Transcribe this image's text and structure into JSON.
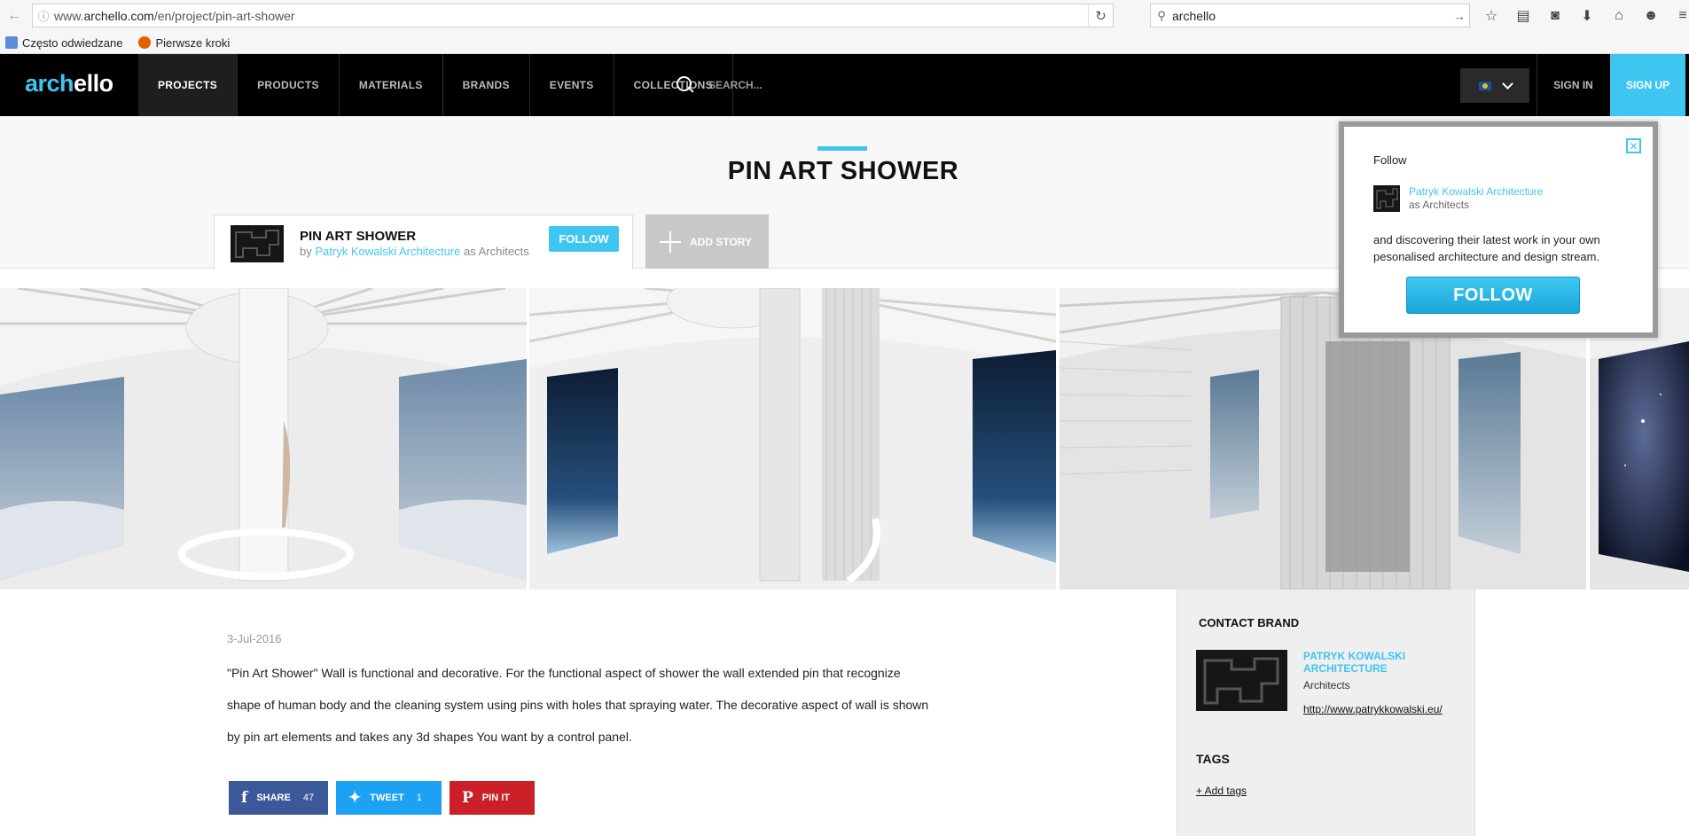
{
  "browser": {
    "url_prefix": "www.",
    "url_domain": "archello.com",
    "url_path": "/en/project/pin-art-shower",
    "search_value": "archello",
    "bookmarks": [
      {
        "label": "Często odwiedzane"
      },
      {
        "label": "Pierwsze kroki"
      }
    ]
  },
  "site": {
    "logo_part1": "arch",
    "logo_part2": "ello",
    "nav": [
      {
        "label": "PROJECTS"
      },
      {
        "label": "PRODUCTS"
      },
      {
        "label": "MATERIALS"
      },
      {
        "label": "BRANDS"
      },
      {
        "label": "EVENTS"
      },
      {
        "label": "COLLECTIONS"
      }
    ],
    "search_placeholder": "SEARCH...",
    "sign_in": "SIGN IN",
    "sign_up": "SIGN UP",
    "accent_color": "#3ec6f0"
  },
  "project": {
    "title": "PIN ART SHOWER",
    "card_title": "PIN ART SHOWER",
    "by_prefix": "by",
    "author": "Patryk Kowalski Architecture",
    "author_role": "as Architects",
    "follow_label": "FOLLOW",
    "add_story_label": "ADD STORY",
    "date": "3-Jul-2016",
    "description": "\"Pin Art Shower\" Wall is functional and decorative. For the functional aspect of shower the wall extended pin that recognize shape of human body and the cleaning system using pins with holes that spraying water. The decorative aspect of wall is shown by pin art elements and takes any 3d shapes You want by a control panel."
  },
  "social": {
    "share_label": "SHARE",
    "share_count": "47",
    "tweet_label": "TWEET",
    "tweet_count": "1",
    "pin_label": "PIN IT"
  },
  "contact": {
    "heading": "CONTACT BRAND",
    "brand_name": "PATRYK KOWALSKI ARCHITECTURE",
    "brand_type": "Architects",
    "brand_url": "http://www.patrykkowalski.eu/",
    "tags_heading": "TAGS",
    "add_tags": "+ Add tags"
  },
  "popup": {
    "close_glyph": "✕",
    "heading": "Follow",
    "brand": "Patryk Kowalski Architecture",
    "role": "as Architects",
    "text": "and discovering their latest work in your own pesonalised architecture and design stream.",
    "follow_label": "FOLLOW"
  }
}
